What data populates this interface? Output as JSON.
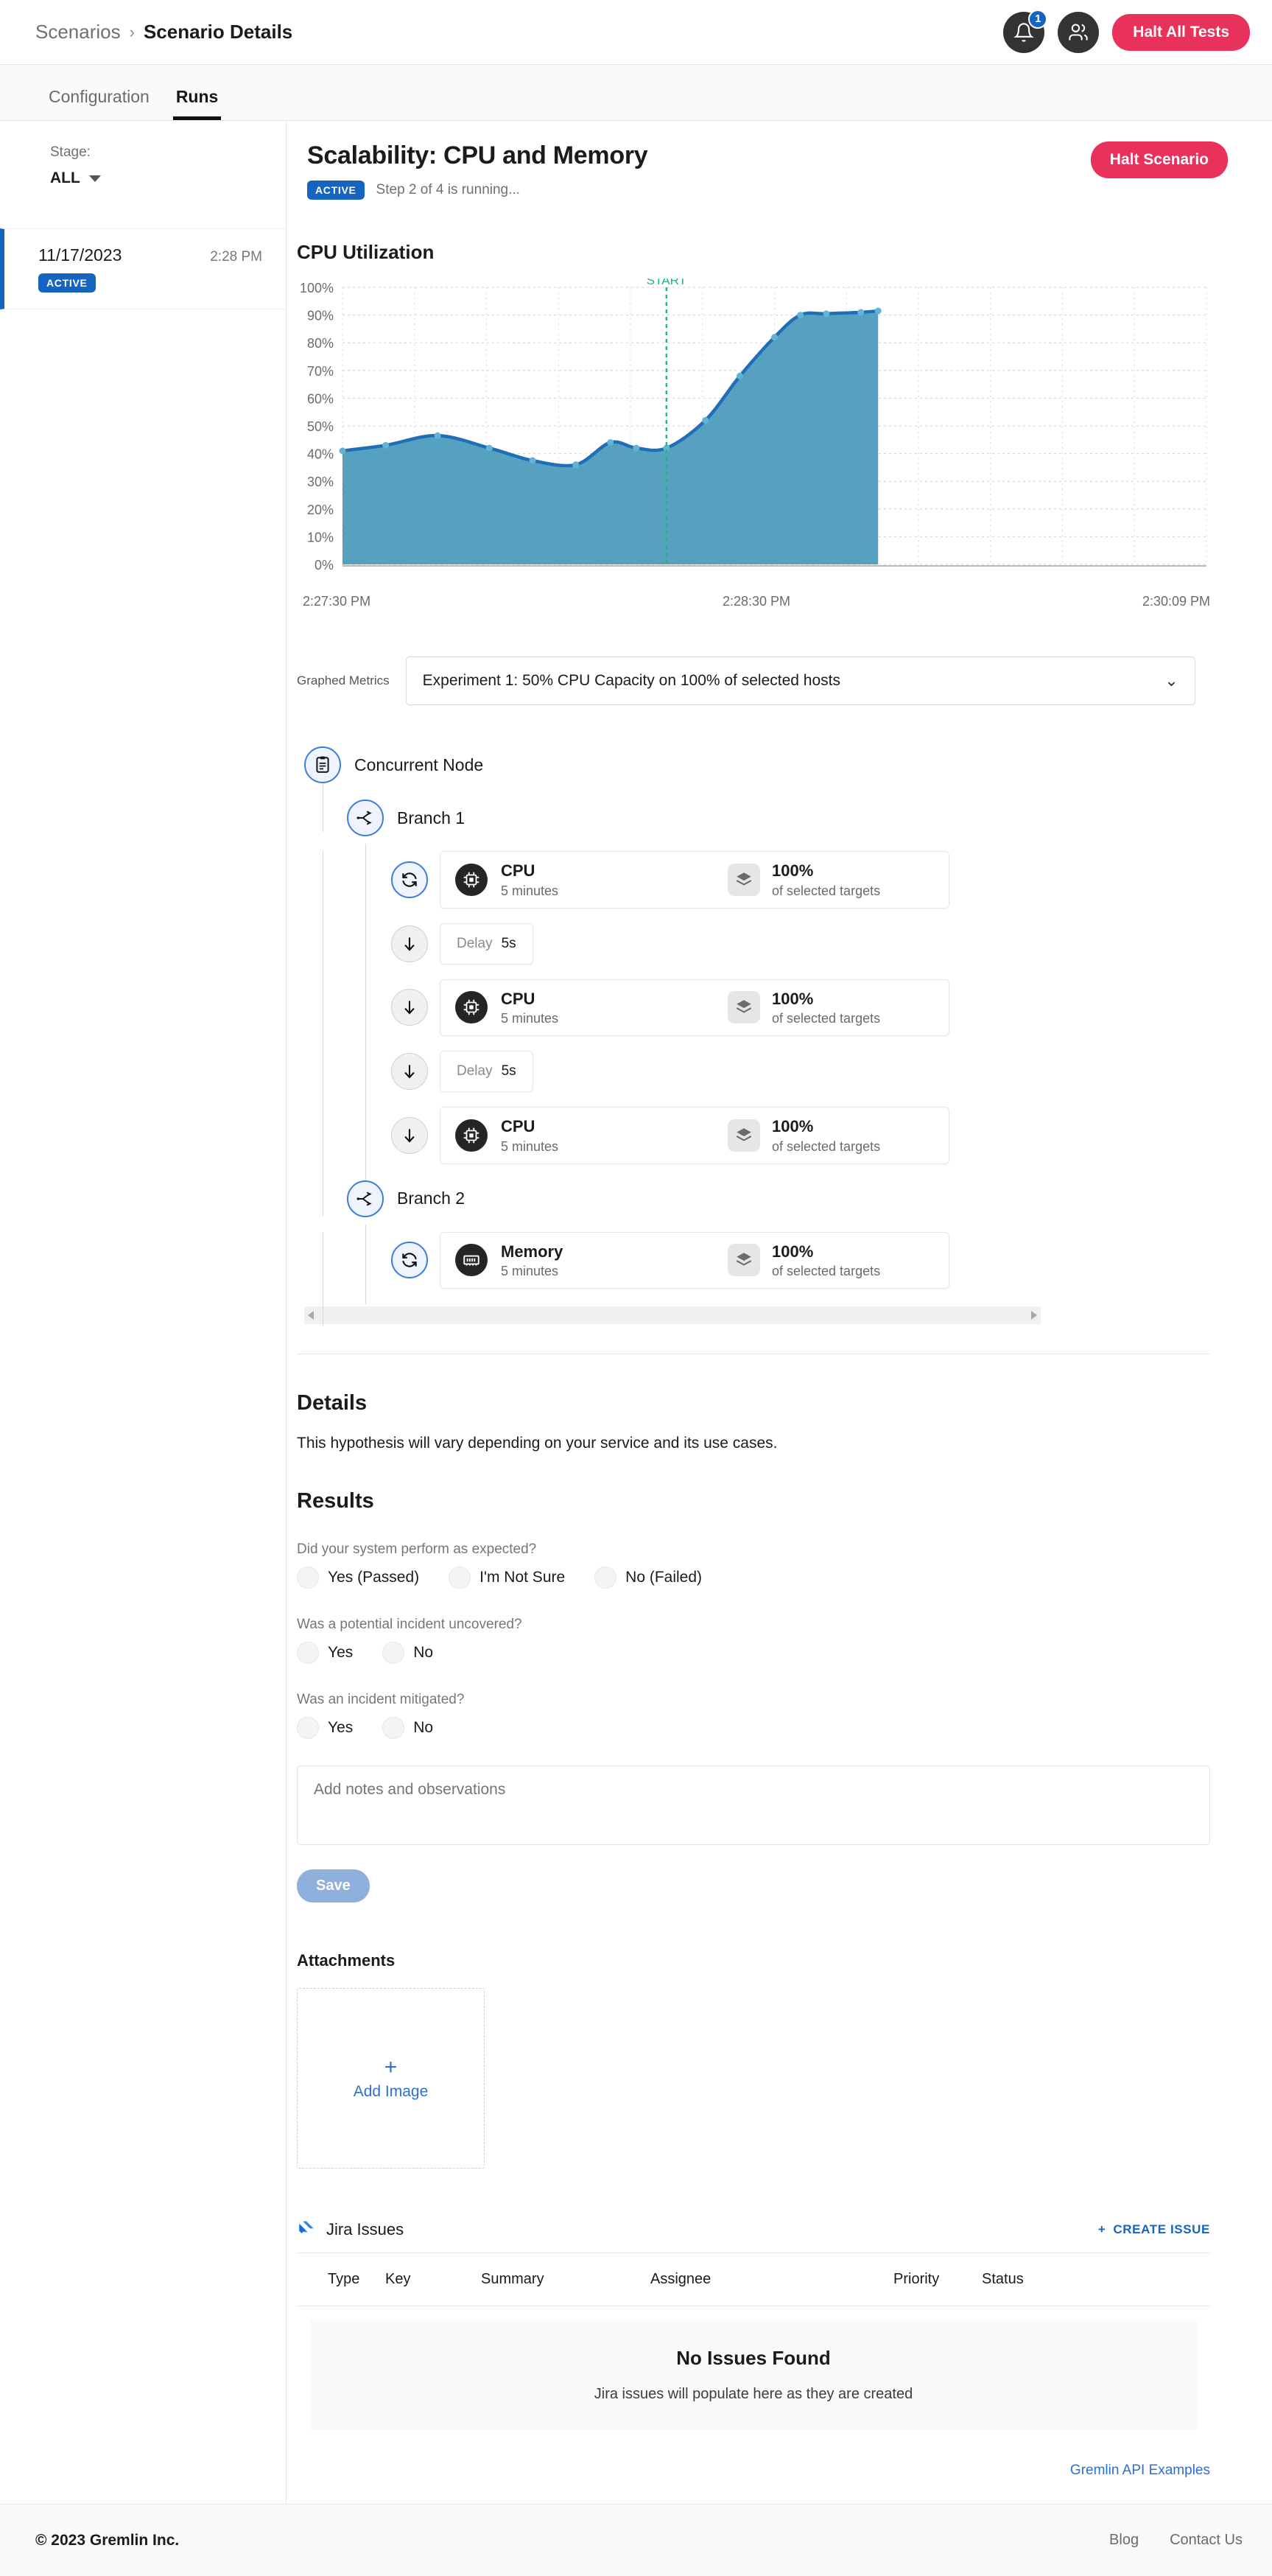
{
  "topbar": {
    "breadcrumb_root": "Scenarios",
    "breadcrumb_sep": "›",
    "breadcrumb_current": "Scenario Details",
    "notification_count": "1",
    "halt_all_label": "Halt All Tests",
    "halt_color": "#e8315b"
  },
  "tabs": [
    {
      "label": "Configuration",
      "active": false
    },
    {
      "label": "Runs",
      "active": true
    }
  ],
  "sidebar": {
    "stage_label": "Stage:",
    "stage_value": "ALL",
    "runs": [
      {
        "date": "11/17/2023",
        "time": "2:28 PM",
        "status": "ACTIVE"
      }
    ]
  },
  "scenario": {
    "title": "Scalability: CPU and Memory",
    "status": "ACTIVE",
    "step_text": "Step 2 of 4 is running...",
    "halt_label": "Halt Scenario"
  },
  "chart_data": {
    "type": "area",
    "title": "CPU Utilization",
    "xlabel": "",
    "ylabel": "",
    "ylim": [
      0,
      100
    ],
    "ytick_labels": [
      "100%",
      "90%",
      "80%",
      "70%",
      "60%",
      "50%",
      "40%",
      "30%",
      "20%",
      "10%",
      "0%"
    ],
    "ytick_values": [
      100,
      90,
      80,
      70,
      60,
      50,
      40,
      30,
      20,
      10,
      0
    ],
    "xtick_labels": [
      "2:27:30 PM",
      "2:28:30 PM",
      "2:30:09 PM"
    ],
    "grid": true,
    "legend": "none",
    "annotation": {
      "label": "START",
      "x_fraction": 0.375,
      "color": "#23b67a"
    },
    "series": [
      {
        "name": "CPU Utilization",
        "color": "#1f6fb8",
        "fill": "#4e9cbd",
        "x": [
          0,
          0.05,
          0.11,
          0.17,
          0.22,
          0.27,
          0.31,
          0.34,
          0.375,
          0.42,
          0.46,
          0.5,
          0.53,
          0.56,
          0.6,
          0.62
        ],
        "values": [
          41,
          43,
          46.5,
          42,
          37.5,
          36,
          44,
          42,
          42,
          52,
          68,
          82,
          90,
          90.5,
          91,
          91.5
        ]
      }
    ]
  },
  "graphed_metrics": {
    "label": "Graphed Metrics",
    "selected": "Experiment 1: 50% CPU Capacity on 100% of selected hosts"
  },
  "flow": {
    "root": {
      "label": "Concurrent Node",
      "icon": "clipboard-icon"
    },
    "branches": [
      {
        "label": "Branch 1",
        "icon": "branch-icon",
        "steps": [
          {
            "type": "attack",
            "badge": "sync-icon",
            "icon": "cpu-icon",
            "name": "CPU",
            "meta": "5 minutes",
            "target_icon": "layers-icon",
            "target_value": "100%",
            "target_meta": "of selected targets"
          },
          {
            "type": "delay",
            "badge": "arrow-down-icon",
            "word": "Delay",
            "value": "5s"
          },
          {
            "type": "attack",
            "badge": "arrow-down-icon",
            "icon": "cpu-icon",
            "name": "CPU",
            "meta": "5 minutes",
            "target_icon": "layers-icon",
            "target_value": "100%",
            "target_meta": "of selected targets"
          },
          {
            "type": "delay",
            "badge": "arrow-down-icon",
            "word": "Delay",
            "value": "5s"
          },
          {
            "type": "attack",
            "badge": "arrow-down-icon",
            "icon": "cpu-icon",
            "name": "CPU",
            "meta": "5 minutes",
            "target_icon": "layers-icon",
            "target_value": "100%",
            "target_meta": "of selected targets"
          }
        ]
      },
      {
        "label": "Branch 2",
        "icon": "branch-icon",
        "steps": [
          {
            "type": "attack",
            "badge": "sync-icon",
            "icon": "memory-icon",
            "name": "Memory",
            "meta": "5 minutes",
            "target_icon": "layers-icon",
            "target_value": "100%",
            "target_meta": "of selected targets"
          }
        ]
      }
    ]
  },
  "details": {
    "heading": "Details",
    "body": "This hypothesis will vary depending on your service and its use cases."
  },
  "results": {
    "heading": "Results",
    "questions": [
      {
        "label": "Did your system perform as expected?",
        "options": [
          "Yes (Passed)",
          "I'm Not Sure",
          "No (Failed)"
        ]
      },
      {
        "label": "Was a potential incident uncovered?",
        "options": [
          "Yes",
          "No"
        ]
      },
      {
        "label": "Was an incident mitigated?",
        "options": [
          "Yes",
          "No"
        ]
      }
    ],
    "notes_placeholder": "Add notes and observations",
    "save_label": "Save"
  },
  "attachments": {
    "heading": "Attachments",
    "add_plus": "+",
    "add_label": "Add Image"
  },
  "jira": {
    "title": "Jira Issues",
    "create_label": "CREATE ISSUE",
    "create_plus": "+",
    "columns": [
      "Type",
      "Key",
      "Summary",
      "Assignee",
      "Priority",
      "Status"
    ],
    "empty_title": "No Issues Found",
    "empty_sub": "Jira issues will populate here as they are created"
  },
  "api_link": "Gremlin API Examples",
  "footer": {
    "copyright": "© 2023 Gremlin Inc.",
    "links": [
      "Blog",
      "Contact Us"
    ]
  }
}
